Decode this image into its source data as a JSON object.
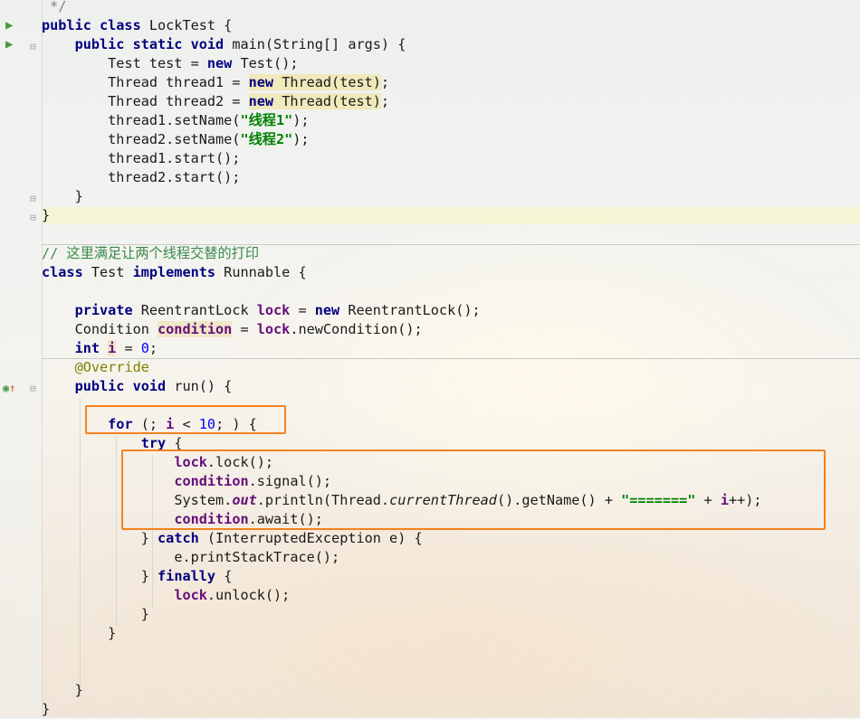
{
  "code": {
    "l_comment_end": "*/",
    "l_class_kw": "public class",
    "l_class_name": " LockTest {",
    "l_main_kw": "public static void",
    "l_main_rest": " main(String[] args) {",
    "l_test_decl": "Test test = ",
    "l_new": "new",
    "l_test_ctor": " Test();",
    "l_t1_decl": "Thread thread1 = ",
    "l_t2_decl": "Thread thread2 = ",
    "l_thread_ctor": " Thread(test)",
    "l_semi": ";",
    "l_setname1_a": "thread1.setName(",
    "l_setname1_str": "\"线程1\"",
    "l_setname2_a": "thread2.setName(",
    "l_setname2_str": "\"线程2\"",
    "l_close_paren": ");",
    "l_start1": "thread1.start();",
    "l_start2": "thread2.start();",
    "l_brace_close": "}",
    "l_comment_cn": "// 这里满足让两个线程交替的打印",
    "l_class2_kw": "class",
    "l_class2_name": " Test ",
    "l_implements": "implements",
    "l_runnable": " Runnable {",
    "l_private": "private",
    "l_reentrant_type": " ReentrantLock ",
    "l_lock": "lock",
    "l_eq": " = ",
    "l_reentrant_ctor": " ReentrantLock();",
    "l_condition_type": "Condition ",
    "l_condition": "condition",
    "l_newcondition": ".newCondition();",
    "l_int": "int",
    "l_i": "i",
    "l_zero": "0",
    "l_override": "@Override",
    "l_public_void": "public void",
    "l_run": " run() {",
    "l_for": "for",
    "l_for_a": " (; ",
    "l_for_b": " < ",
    "l_ten": "10",
    "l_for_c": "; ) {",
    "l_try": "try",
    "l_brace_open": " {",
    "l_lock_call": ".lock();",
    "l_signal_call": ".signal();",
    "l_sysout_a": "System.",
    "l_out": "out",
    "l_println_a": ".println(Thread.",
    "l_current_thread": "currentThread",
    "l_println_b": "().getName() + ",
    "l_eq_str": "\"=======\"",
    "l_plus": " + ",
    "l_iplusplus": "++);",
    "l_await_call": ".await();",
    "l_catch_close": "} ",
    "l_catch": "catch",
    "l_catch_rest": " (InterruptedException e) {",
    "l_print_stack": "e.printStackTrace();",
    "l_finally": "finally",
    "l_unlock_call": ".unlock();",
    "l_top_brace": "}"
  },
  "colors": {
    "keyword": "#000080",
    "field": "#660e7a",
    "string": "#008000",
    "number": "#0000ff",
    "annotation": "#808000",
    "highlight_box": "#f5821f"
  },
  "icons": {
    "run_gutter": "run-triangle-icon",
    "override_gutter": "override-method-icon",
    "fold": "fold-marker-icon"
  }
}
